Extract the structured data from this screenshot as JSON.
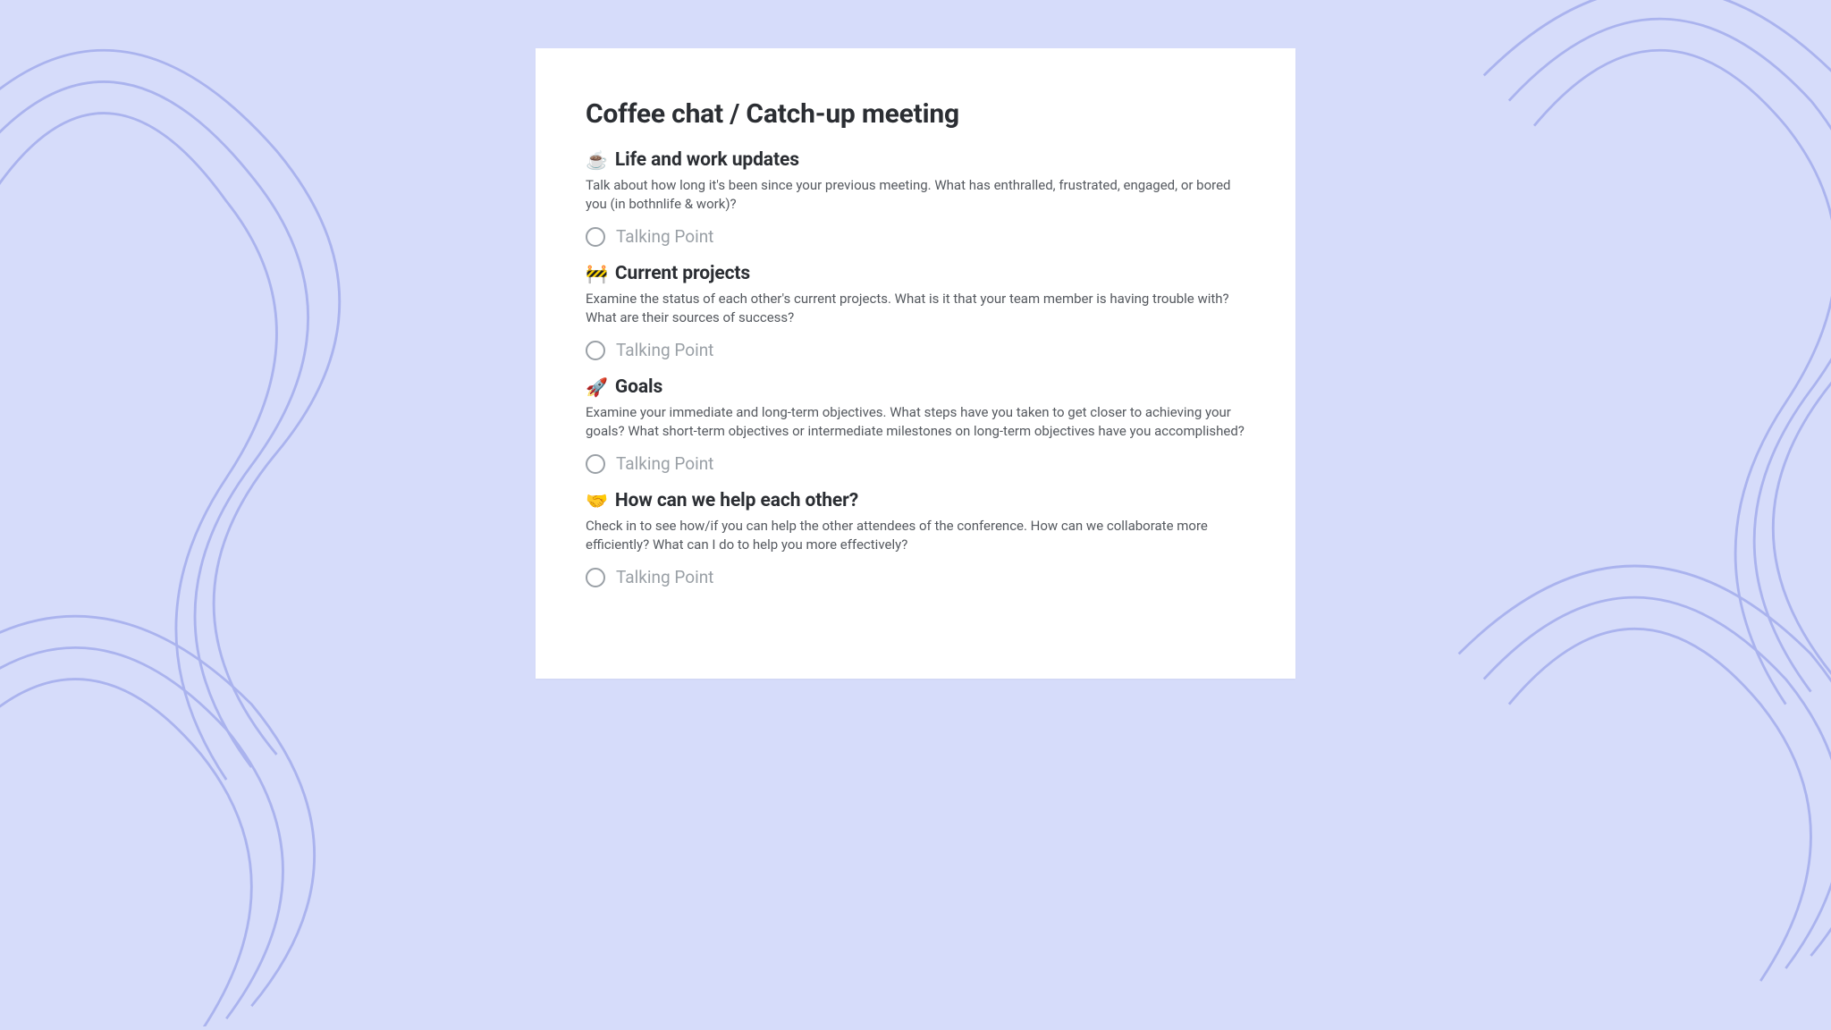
{
  "doc": {
    "title": "Coffee chat / Catch-up meeting"
  },
  "sections": [
    {
      "emoji": "☕",
      "title": "Life and work updates",
      "desc": "Talk about how long it's been since your previous meeting. What has enthralled, frustrated, engaged, or bored you (in bothnlife & work)?",
      "placeholder": "Talking Point"
    },
    {
      "emoji": "🚧",
      "title": "Current projects",
      "desc": "Examine the status of each other's current projects. What is it that your team member is having trouble with? What are their sources of success?",
      "placeholder": "Talking Point"
    },
    {
      "emoji": "🚀",
      "title": "Goals",
      "desc": "Examine your immediate and long-term objectives. What steps have you taken to get closer to achieving your goals? What short-term objectives or intermediate milestones on long-term objectives have you accomplished?",
      "placeholder": "Talking Point"
    },
    {
      "emoji": "🤝",
      "title": "How can we help each other?",
      "desc": "Check in to see how/if you can help the other attendees of the conference. How can we collaborate more efficiently? What can I do to help you more effectively?",
      "placeholder": "Talking Point"
    }
  ]
}
